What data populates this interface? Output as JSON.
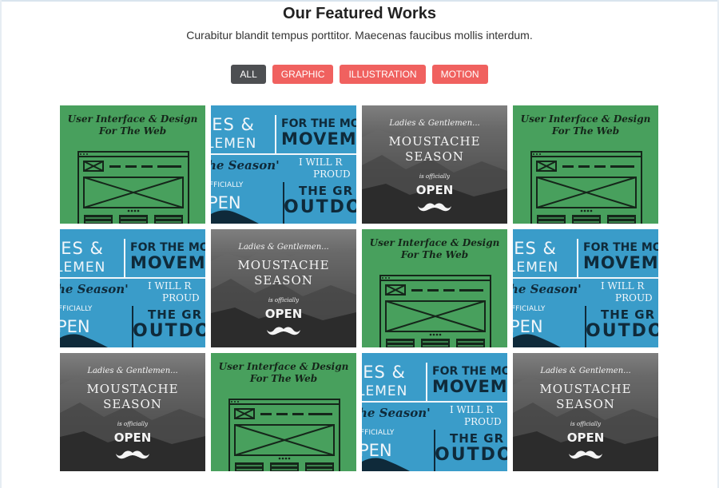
{
  "header": {
    "title": "Our Featured Works",
    "subtitle": "Curabitur blandit tempus porttitor. Maecenas faucibus mollis interdum."
  },
  "filters": [
    {
      "label": "ALL",
      "active": true
    },
    {
      "label": "GRAPHIC",
      "active": false
    },
    {
      "label": "ILLUSTRATION",
      "active": false
    },
    {
      "label": "MOTION",
      "active": false
    }
  ],
  "colors": {
    "active_filter": "#4d4f52",
    "filter": "#f0615f",
    "ui_tile": "#48a05d",
    "poster_tile": "#3a9cc9"
  },
  "works": {
    "ui": {
      "line1": "User Interface & Design",
      "line2": "For The Web"
    },
    "poster": {
      "l1": "IES &",
      "l2": "LEMEN",
      "r1": "FOR THE MO",
      "r2": "MOVEM",
      "season": "he Season'",
      "will": "I WILL R",
      "proud": "PROUD",
      "officially": "FFICIALLY",
      "pen": "PEN",
      "gr": "THE GR",
      "outdo": "OUTDO"
    },
    "moustache": {
      "ladies": "Ladies & Gentlemen...",
      "title1": "MOUSTACHE",
      "title2": "SEASON",
      "official": "is officially",
      "open": "OPEN"
    }
  }
}
